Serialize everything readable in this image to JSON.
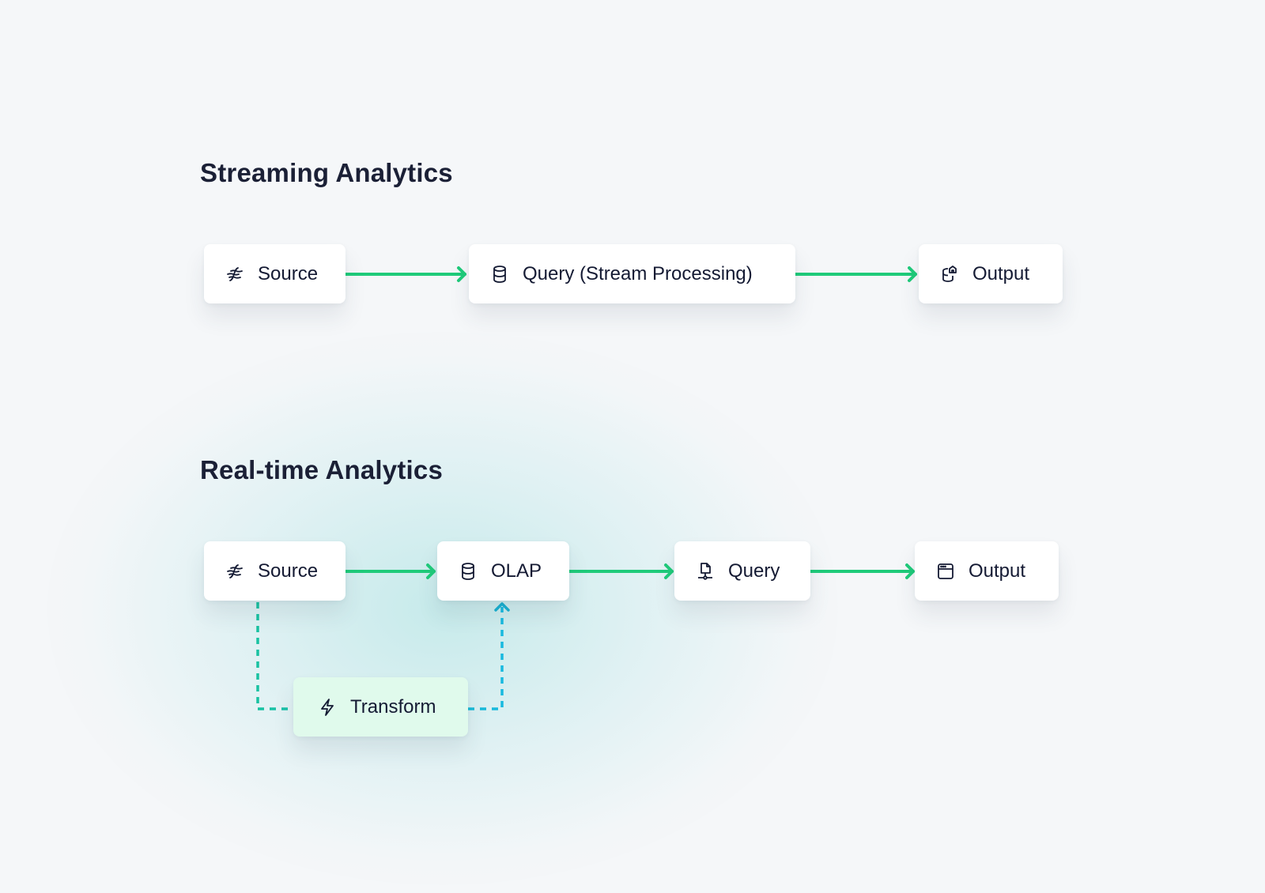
{
  "sections": [
    {
      "title": "Streaming Analytics",
      "nodes": [
        {
          "label": "Source",
          "icon": "stream-waves-icon"
        },
        {
          "label": "Query (Stream Processing)",
          "icon": "database-icon"
        },
        {
          "label": "Output",
          "icon": "database-export-icon"
        }
      ]
    },
    {
      "title": "Real-time Analytics",
      "nodes": [
        {
          "label": "Source",
          "icon": "stream-waves-icon"
        },
        {
          "label": "OLAP",
          "icon": "database-icon"
        },
        {
          "label": "Query",
          "icon": "file-network-icon"
        },
        {
          "label": "Output",
          "icon": "browser-window-icon"
        }
      ],
      "side_node": {
        "label": "Transform",
        "icon": "lightning-bolt-icon"
      }
    }
  ],
  "colors": {
    "arrow": "#1fcb7a",
    "dashed_start": "#18c58f",
    "dashed_end": "#18b9e0",
    "transform_bg": "#e0faec",
    "text": "#141a33"
  }
}
